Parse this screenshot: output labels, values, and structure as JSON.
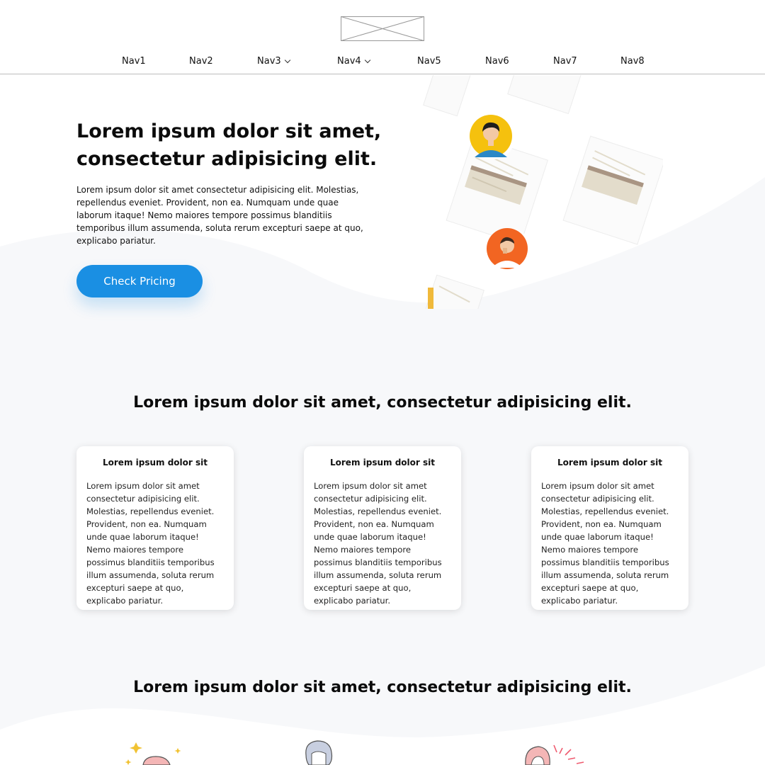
{
  "header": {
    "logo_alt": "logo-placeholder",
    "nav": [
      {
        "label": "Nav1",
        "has_dropdown": false
      },
      {
        "label": "Nav2",
        "has_dropdown": false
      },
      {
        "label": "Nav3",
        "has_dropdown": true
      },
      {
        "label": "Nav4",
        "has_dropdown": true
      },
      {
        "label": "Nav5",
        "has_dropdown": false
      },
      {
        "label": "Nav6",
        "has_dropdown": false
      },
      {
        "label": "Nav7",
        "has_dropdown": false
      },
      {
        "label": "Nav8",
        "has_dropdown": false
      }
    ]
  },
  "hero": {
    "title": "Lorem ipsum dolor sit amet, consectetur adipisicing elit.",
    "text": "Lorem ipsum dolor sit amet consectetur adipisicing elit. Molestias, repellendus eveniet. Provident, non ea. Numquam unde quae laborum itaque! Nemo maiores tempore possimus blanditiis temporibus illum assumenda, soluta rerum excepturi saepe at quo, explicabo pariatur.",
    "cta_label": "Check Pricing"
  },
  "features": {
    "title": "Lorem ipsum dolor sit amet, consectetur adipisicing elit.",
    "cards": [
      {
        "title": "Lorem ipsum dolor sit",
        "text": "Lorem ipsum dolor sit amet consectetur adipisicing elit. Molestias, repellendus eveniet. Provident, non ea. Numquam unde quae laborum itaque! Nemo maiores tempore possimus blanditiis temporibus illum assumenda, soluta rerum excepturi saepe at quo, explicabo pariatur."
      },
      {
        "title": "Lorem ipsum dolor sit",
        "text": "Lorem ipsum dolor sit amet consectetur adipisicing elit. Molestias, repellendus eveniet. Provident, non ea. Numquam unde quae laborum itaque! Nemo maiores tempore possimus blanditiis temporibus illum assumenda, soluta rerum excepturi saepe at quo, explicabo pariatur."
      },
      {
        "title": "Lorem ipsum dolor sit",
        "text": "Lorem ipsum dolor sit amet consectetur adipisicing elit. Molestias, repellendus eveniet. Provident, non ea. Numquam unde quae laborum itaque! Nemo maiores tempore possimus blanditiis temporibus illum assumenda, soluta rerum excepturi saepe at quo, explicabo pariatur."
      }
    ]
  },
  "testimonials": {
    "title": "Lorem ipsum dolor sit amet, consectetur adipisicing elit."
  },
  "colors": {
    "accent": "#1a8fe3",
    "section_bg": "#f7f8fa",
    "avatar_yellow": "#f5c10e",
    "avatar_orange": "#f26522"
  }
}
